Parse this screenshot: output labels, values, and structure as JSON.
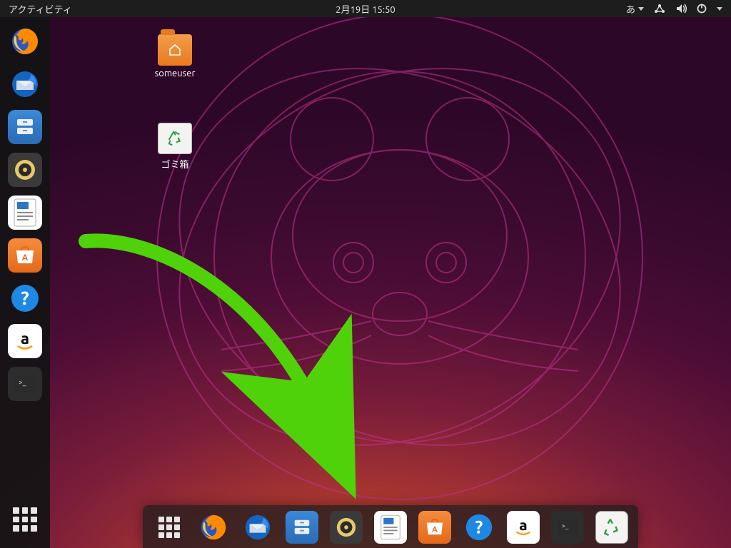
{
  "topbar": {
    "activities_label": "アクティビティ",
    "clock": "2月19日  15:50",
    "ime_label": "あ"
  },
  "desktop_icons": {
    "home_label": "someuser",
    "trash_label": "ゴミ箱"
  },
  "left_dock": {
    "items": [
      {
        "name": "firefox"
      },
      {
        "name": "thunderbird"
      },
      {
        "name": "files"
      },
      {
        "name": "rhythmbox"
      },
      {
        "name": "libreoffice-writer"
      },
      {
        "name": "ubuntu-software"
      },
      {
        "name": "help"
      },
      {
        "name": "amazon"
      },
      {
        "name": "terminal"
      }
    ]
  },
  "bottom_dock": {
    "items": [
      {
        "name": "show-applications"
      },
      {
        "name": "firefox"
      },
      {
        "name": "thunderbird"
      },
      {
        "name": "files"
      },
      {
        "name": "rhythmbox"
      },
      {
        "name": "libreoffice-writer"
      },
      {
        "name": "ubuntu-software"
      },
      {
        "name": "help"
      },
      {
        "name": "amazon"
      },
      {
        "name": "terminal"
      },
      {
        "name": "trash"
      }
    ]
  },
  "colors": {
    "annotation_arrow": "#4fd20a"
  }
}
